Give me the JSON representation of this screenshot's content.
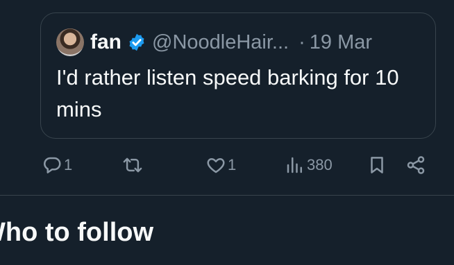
{
  "quote": {
    "author_name": "fan",
    "handle": "@NoodleHair...",
    "separator": "·",
    "date": "19 Mar",
    "text": "I'd rather listen speed barking for 10 mins"
  },
  "actions": {
    "reply_count": "1",
    "like_count": "1",
    "view_count": "380"
  },
  "section": {
    "title": "Who to follow"
  },
  "colors": {
    "background": "#15202b",
    "border": "#38444d",
    "muted": "#8b98a5",
    "verified": "#1d9bf0"
  }
}
